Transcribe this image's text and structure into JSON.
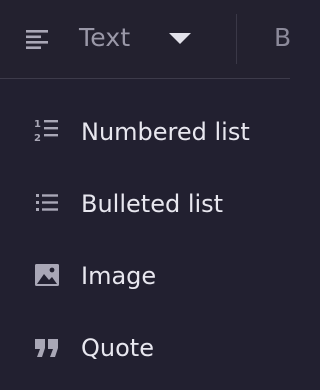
{
  "toolbar": {
    "type_dropdown": {
      "icon": "paragraph-text-icon",
      "selected": "Text",
      "chevron_icon": "caret-down-icon"
    },
    "next_tool_partial": "B"
  },
  "menu": {
    "items": [
      {
        "icon": "numbered-list-icon",
        "label": "Numbered list"
      },
      {
        "icon": "bulleted-list-icon",
        "label": "Bulleted list"
      },
      {
        "icon": "image-icon",
        "label": "Image"
      },
      {
        "icon": "quote-icon",
        "label": "Quote"
      }
    ]
  },
  "colors": {
    "background": "#222030",
    "toolbar_text": "#9a98a8",
    "menu_text": "#e8e7ef",
    "icon": "#a9a7b6"
  }
}
